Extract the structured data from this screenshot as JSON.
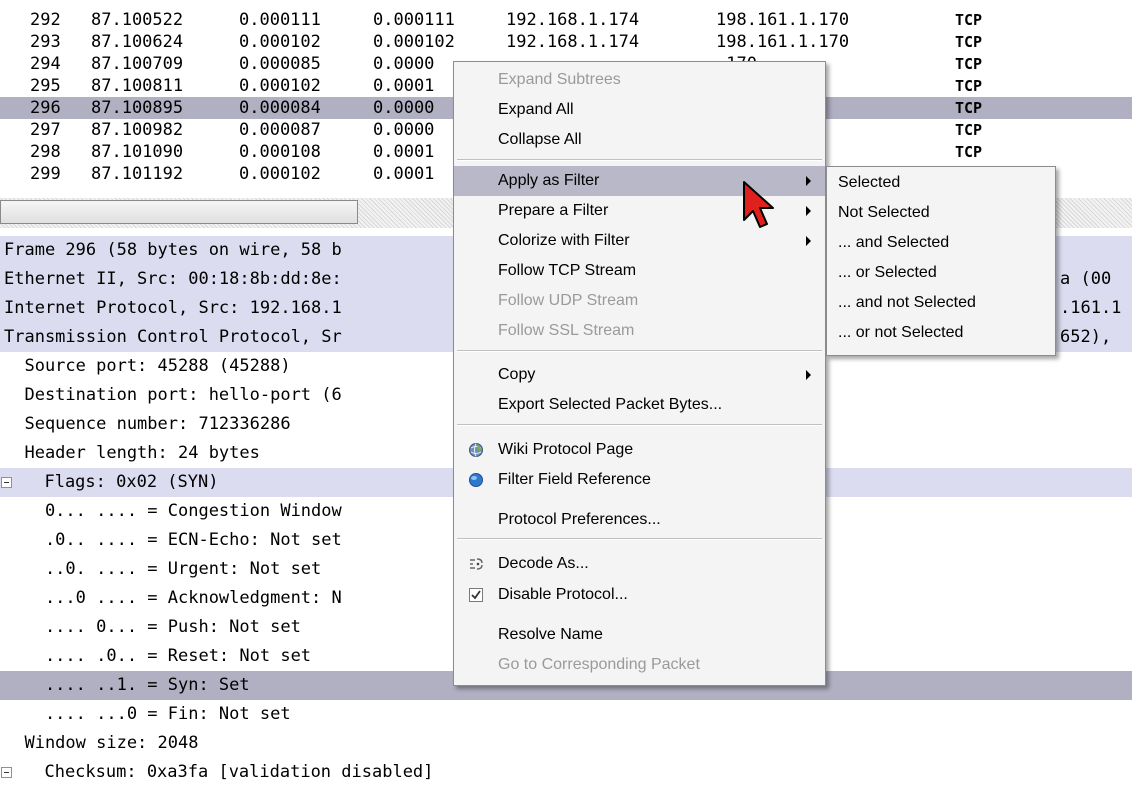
{
  "packet_list": {
    "rows": [
      {
        "no": "292",
        "time": "87.100522",
        "delta": "0.000111",
        "delta2": "0.000111",
        "src": "192.168.1.174",
        "dst": "198.161.1.170",
        "proto": "TCP",
        "selected": false
      },
      {
        "no": "293",
        "time": "87.100624",
        "delta": "0.000102",
        "delta2": "0.000102",
        "src": "192.168.1.174",
        "dst": "198.161.1.170",
        "proto": "TCP",
        "selected": false
      },
      {
        "no": "294",
        "time": "87.100709",
        "delta": "0.000085",
        "delta2": "0.0000",
        "src": "",
        "dst": ".170",
        "proto": "TCP",
        "selected": false
      },
      {
        "no": "295",
        "time": "87.100811",
        "delta": "0.000102",
        "delta2": "0.0001",
        "src": "",
        "dst": ".170",
        "proto": "TCP",
        "selected": false
      },
      {
        "no": "296",
        "time": "87.100895",
        "delta": "0.000084",
        "delta2": "0.0000",
        "src": "",
        "dst": ".170",
        "proto": "TCP",
        "selected": true
      },
      {
        "no": "297",
        "time": "87.100982",
        "delta": "0.000087",
        "delta2": "0.0000",
        "src": "",
        "dst": ".170",
        "proto": "TCP",
        "selected": false
      },
      {
        "no": "298",
        "time": "87.101090",
        "delta": "0.000108",
        "delta2": "0.0001",
        "src": "",
        "dst": "170",
        "proto": "TCP",
        "selected": false
      },
      {
        "no": "299",
        "time": "87.101192",
        "delta": "0.000102",
        "delta2": "0.0001",
        "src": "",
        "dst": "",
        "proto": "",
        "selected": false
      }
    ]
  },
  "details": {
    "rows": [
      {
        "text": "Frame 296 (58 bytes on wire, 58 b",
        "tail": "",
        "style": "hdr",
        "expander": false
      },
      {
        "text": "Ethernet II, Src: 00:18:8b:dd:8e:",
        "tail": "a (00",
        "style": "hdr",
        "expander": false
      },
      {
        "text": "Internet Protocol, Src: 192.168.1",
        "tail": ".161.1",
        "style": "hdr",
        "expander": false
      },
      {
        "text": "Transmission Control Protocol, Sr",
        "tail": "652),",
        "style": "hdr",
        "expander": false
      },
      {
        "text": "  Source port: 45288 (45288)",
        "tail": "",
        "style": "",
        "expander": false
      },
      {
        "text": "  Destination port: hello-port (6",
        "tail": "",
        "style": "",
        "expander": false
      },
      {
        "text": "  Sequence number: 712336286",
        "tail": "",
        "style": "",
        "expander": false
      },
      {
        "text": "  Header length: 24 bytes",
        "tail": "",
        "style": "",
        "expander": false
      },
      {
        "text": "  Flags: 0x02 (SYN)",
        "tail": "",
        "style": "hdr",
        "expander": true
      },
      {
        "text": "    0... .... = Congestion Window",
        "tail": "",
        "style": "",
        "expander": false
      },
      {
        "text": "    .0.. .... = ECN-Echo: Not set",
        "tail": "",
        "style": "",
        "expander": false
      },
      {
        "text": "    ..0. .... = Urgent: Not set",
        "tail": "",
        "style": "",
        "expander": false
      },
      {
        "text": "    ...0 .... = Acknowledgment: N",
        "tail": "",
        "style": "",
        "expander": false
      },
      {
        "text": "    .... 0... = Push: Not set",
        "tail": "",
        "style": "",
        "expander": false
      },
      {
        "text": "    .... .0.. = Reset: Not set",
        "tail": "",
        "style": "",
        "expander": false
      },
      {
        "text": "    .... ..1. = Syn: Set",
        "tail": "",
        "style": "sel",
        "expander": false
      },
      {
        "text": "    .... ...0 = Fin: Not set",
        "tail": "",
        "style": "",
        "expander": false
      },
      {
        "text": "  Window size: 2048",
        "tail": "",
        "style": "",
        "expander": false
      },
      {
        "text": "  Checksum: 0xa3fa [validation disabled]",
        "tail": "",
        "style": "",
        "expander": true
      }
    ]
  },
  "context_menu": {
    "items": [
      {
        "label": "Expand Subtrees",
        "disabled": true,
        "submenu": false,
        "icon": ""
      },
      {
        "label": "Expand All",
        "disabled": false,
        "submenu": false,
        "icon": ""
      },
      {
        "label": "Collapse All",
        "disabled": false,
        "submenu": false,
        "icon": ""
      },
      {
        "label": "Apply as Filter",
        "disabled": false,
        "submenu": true,
        "icon": "",
        "highlighted": true
      },
      {
        "label": "Prepare a Filter",
        "disabled": false,
        "submenu": true,
        "icon": ""
      },
      {
        "label": "Colorize with Filter",
        "disabled": false,
        "submenu": true,
        "icon": ""
      },
      {
        "label": "Follow TCP Stream",
        "disabled": false,
        "submenu": false,
        "icon": ""
      },
      {
        "label": "Follow UDP Stream",
        "disabled": true,
        "submenu": false,
        "icon": ""
      },
      {
        "label": "Follow SSL Stream",
        "disabled": true,
        "submenu": false,
        "icon": ""
      },
      {
        "label": "Copy",
        "disabled": false,
        "submenu": true,
        "icon": ""
      },
      {
        "label": "Export Selected Packet Bytes...",
        "disabled": false,
        "submenu": false,
        "icon": ""
      },
      {
        "label": "Wiki Protocol Page",
        "disabled": false,
        "submenu": false,
        "icon": "globe-icon"
      },
      {
        "label": "Filter Field Reference",
        "disabled": false,
        "submenu": false,
        "icon": "blue-globe-icon"
      },
      {
        "label": "Protocol Preferences...",
        "disabled": false,
        "submenu": false,
        "icon": ""
      },
      {
        "label": "Decode As...",
        "disabled": false,
        "submenu": false,
        "icon": "decode-icon"
      },
      {
        "label": "Disable Protocol...",
        "disabled": false,
        "submenu": false,
        "icon": "checkbox-icon"
      },
      {
        "label": "Resolve Name",
        "disabled": false,
        "submenu": false,
        "icon": ""
      },
      {
        "label": "Go to Corresponding Packet",
        "disabled": true,
        "submenu": false,
        "icon": ""
      }
    ]
  },
  "filter_submenu": {
    "items": [
      {
        "label": "Selected"
      },
      {
        "label": "Not Selected"
      },
      {
        "label": "... and Selected"
      },
      {
        "label": "... or Selected"
      },
      {
        "label": "... and not Selected"
      },
      {
        "label": "... or not Selected"
      }
    ]
  },
  "colors": {
    "selected_row": "#b0b0c2",
    "header_row": "#dcdcf0",
    "menu_bg": "#f4f4f4",
    "menu_highlight": "#b8b8c8",
    "disabled_text": "#9a9a9a",
    "cursor": "#e0201c"
  }
}
